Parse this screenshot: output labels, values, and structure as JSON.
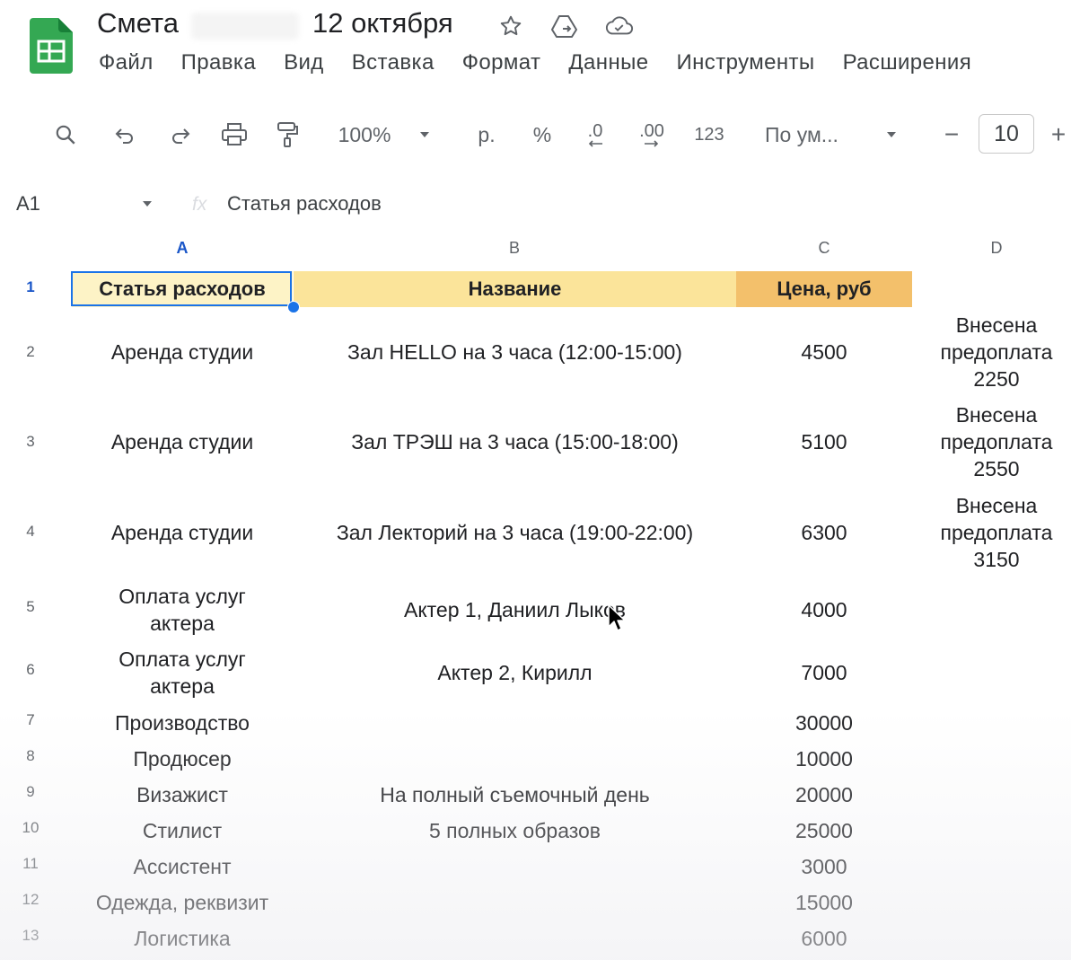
{
  "app": {
    "doc_title": "Смета",
    "doc_title_suffix": "12 октября",
    "icons": [
      "star-icon",
      "move-to-drive-icon",
      "cloud-saved-icon"
    ]
  },
  "menu": [
    "Файл",
    "Правка",
    "Вид",
    "Вставка",
    "Формат",
    "Данные",
    "Инструменты",
    "Расширения"
  ],
  "toolbar": {
    "zoom": "100%",
    "currency": "р.",
    "percent": "%",
    "decrease_decimal": ".0",
    "increase_decimal": ".00",
    "number_format": "123",
    "font": "По ум...",
    "font_size": "10",
    "minus": "−",
    "plus": "+"
  },
  "formula_bar": {
    "name_box": "A1",
    "fx": "fx",
    "content": "Статья расходов"
  },
  "columns": [
    "A",
    "B",
    "C",
    "D"
  ],
  "rows": [
    {
      "n": "1",
      "a": "Статья расходов",
      "b": "Название",
      "c": "Цена, руб",
      "d": ""
    },
    {
      "n": "2",
      "a": "Аренда студии",
      "b": "Зал HELLO на 3 часа (12:00-15:00)",
      "c": "4500",
      "d": "Внесена предоплата 2250"
    },
    {
      "n": "3",
      "a": "Аренда студии",
      "b": "Зал ТРЭШ на 3 часа (15:00-18:00)",
      "c": "5100",
      "d": "Внесена предоплата 2550"
    },
    {
      "n": "4",
      "a": "Аренда студии",
      "b": "Зал Лекторий на 3 часа (19:00-22:00)",
      "c": "6300",
      "d": "Внесена предоплата 3150"
    },
    {
      "n": "5",
      "a": "Оплата услуг актера",
      "b": "Актер 1, Даниил Лыков",
      "c": "4000",
      "d": ""
    },
    {
      "n": "6",
      "a": "Оплата услуг актера",
      "b": "Актер 2, Кирилл",
      "c": "7000",
      "d": ""
    },
    {
      "n": "7",
      "a": "Производство",
      "b": "",
      "c": "30000",
      "d": ""
    },
    {
      "n": "8",
      "a": "Продюсер",
      "b": "",
      "c": "10000",
      "d": ""
    },
    {
      "n": "9",
      "a": "Визажист",
      "b": "На полный съемочный день",
      "c": "20000",
      "d": ""
    },
    {
      "n": "10",
      "a": "Стилист",
      "b": "5 полных образов",
      "c": "25000",
      "d": ""
    },
    {
      "n": "11",
      "a": "Ассистент",
      "b": "",
      "c": "3000",
      "d": ""
    },
    {
      "n": "12",
      "a": "Одежда, реквизит",
      "b": "",
      "c": "15000",
      "d": ""
    },
    {
      "n": "13",
      "a": "Логистика",
      "b": "",
      "c": "6000",
      "d": ""
    }
  ],
  "colors": {
    "header_a": "#fdf3c6",
    "header_b": "#fbe49a",
    "header_c": "#f3c06b",
    "selection": "#1a73e8",
    "sheets_green": "#34a853"
  }
}
